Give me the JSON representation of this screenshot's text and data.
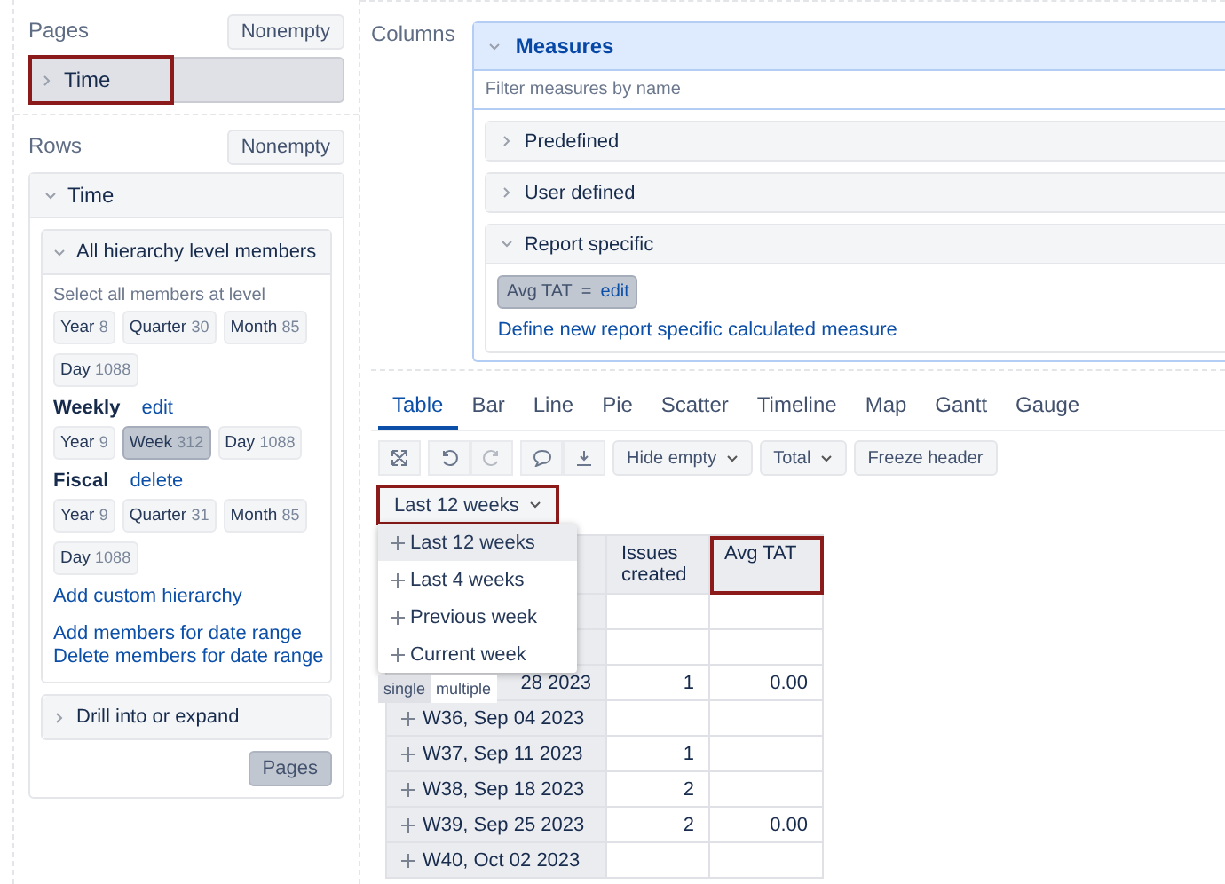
{
  "pages": {
    "label": "Pages",
    "button": "Nonempty",
    "dimension": {
      "label": "Time",
      "expanded": false,
      "highlighted": true
    }
  },
  "rows": {
    "label": "Rows",
    "button": "Nonempty",
    "dimension": {
      "label": "Time",
      "expanded": true
    },
    "hierarchy": {
      "label": "All hierarchy level members",
      "expanded": true,
      "hint": "Select all members at level",
      "groups": [
        {
          "levels": [
            {
              "name": "Year",
              "count": "8",
              "selected": false
            },
            {
              "name": "Quarter",
              "count": "30",
              "selected": false
            },
            {
              "name": "Month",
              "count": "85",
              "selected": false
            },
            {
              "name": "Day",
              "count": "1088",
              "selected": false
            }
          ]
        },
        {
          "title": "Weekly",
          "action": "edit",
          "levels": [
            {
              "name": "Year",
              "count": "9",
              "selected": false
            },
            {
              "name": "Week",
              "count": "312",
              "selected": true
            },
            {
              "name": "Day",
              "count": "1088",
              "selected": false
            }
          ]
        },
        {
          "title": "Fiscal",
          "action": "delete",
          "levels": [
            {
              "name": "Year",
              "count": "9",
              "selected": false
            },
            {
              "name": "Quarter",
              "count": "31",
              "selected": false
            },
            {
              "name": "Month",
              "count": "85",
              "selected": false
            },
            {
              "name": "Day",
              "count": "1088",
              "selected": false
            }
          ]
        }
      ],
      "custom_link": "Add custom hierarchy",
      "range_links": [
        "Add members for date range",
        "Delete members for date range"
      ]
    },
    "drill": {
      "label": "Drill into or expand",
      "expanded": false
    },
    "pages_button": "Pages"
  },
  "columns": {
    "label": "Columns",
    "measures": {
      "label": "Measures",
      "expanded": true,
      "placeholder": "Filter measures by name",
      "folders": [
        {
          "label": "Predefined",
          "expanded": false
        },
        {
          "label": "User defined",
          "expanded": false
        },
        {
          "label": "Report specific",
          "expanded": true
        }
      ],
      "chip": {
        "name": "Avg TAT",
        "sign": "=",
        "action": "edit"
      },
      "link": "Define new report specific calculated measure"
    }
  },
  "tabs": [
    {
      "label": "Table",
      "selected": true
    },
    {
      "label": "Bar",
      "selected": false
    },
    {
      "label": "Line",
      "selected": false
    },
    {
      "label": "Pie",
      "selected": false
    },
    {
      "label": "Scatter",
      "selected": false
    },
    {
      "label": "Timeline",
      "selected": false
    },
    {
      "label": "Map",
      "selected": false
    },
    {
      "label": "Gantt",
      "selected": false
    },
    {
      "label": "Gauge",
      "selected": false
    }
  ],
  "toolbar": {
    "hide_empty": "Hide empty",
    "total": "Total",
    "freeze": "Freeze header"
  },
  "filter": {
    "label": "Last 12 weeks",
    "highlighted": true,
    "menu": [
      {
        "label": "Last 12 weeks",
        "selected": true
      },
      {
        "label": "Last 4 weeks",
        "selected": false
      },
      {
        "label": "Previous week",
        "selected": false
      },
      {
        "label": "Current week",
        "selected": false
      }
    ],
    "modes": [
      {
        "label": "single",
        "selected": true
      },
      {
        "label": "multiple",
        "selected": false
      }
    ]
  },
  "table": {
    "columns": [
      {
        "label": "Issues created",
        "highlighted": false
      },
      {
        "label": "Avg TAT",
        "highlighted": true
      }
    ],
    "rows": [
      {
        "cells": [
          "",
          ""
        ]
      },
      {
        "cells": [
          "",
          ""
        ]
      },
      {
        "label": "28 2023",
        "cells": [
          "1",
          "0.00"
        ]
      },
      {
        "label": "W36, Sep 04 2023",
        "cells": [
          "",
          ""
        ]
      },
      {
        "label": "W37, Sep 11 2023",
        "cells": [
          "1",
          ""
        ]
      },
      {
        "label": "W38, Sep 18 2023",
        "cells": [
          "2",
          ""
        ]
      },
      {
        "label": "W39, Sep 25 2023",
        "cells": [
          "2",
          "0.00"
        ]
      },
      {
        "label": "W40, Oct 02 2023",
        "cells": [
          "",
          ""
        ]
      }
    ]
  }
}
